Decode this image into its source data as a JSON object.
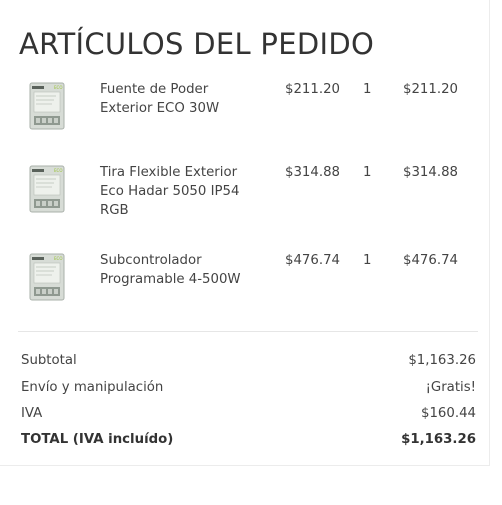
{
  "order": {
    "title": "ARTÍCULOS DEL PEDIDO",
    "items": [
      {
        "name": "Fuente de Poder Exterior ECO 30W",
        "price": "$211.20",
        "qty": "1",
        "total": "$211.20",
        "image_icon": "power-supply-product-icon"
      },
      {
        "name": "Tira Flexible Exterior Eco Hadar 5050 IP54 RGB",
        "price": "$314.88",
        "qty": "1",
        "total": "$314.88",
        "image_icon": "power-supply-product-icon"
      },
      {
        "name": "Subcontrolador Programable 4-500W",
        "price": "$476.74",
        "qty": "1",
        "total": "$476.74",
        "image_icon": "power-supply-product-icon"
      }
    ],
    "summary": {
      "subtotal_label": "Subtotal",
      "subtotal_value": "$1,163.26",
      "shipping_label": "Envío y manipulación",
      "shipping_value": "¡Gratis!",
      "tax_label": "IVA",
      "tax_value": "$160.44",
      "grand_total_label": "TOTAL (IVA incluído)",
      "grand_total_value": "$1,163.26"
    },
    "colors": {
      "product_body": "#cfd6d0",
      "product_panel": "#9aa49c",
      "product_logo": "#9bc43a"
    }
  }
}
